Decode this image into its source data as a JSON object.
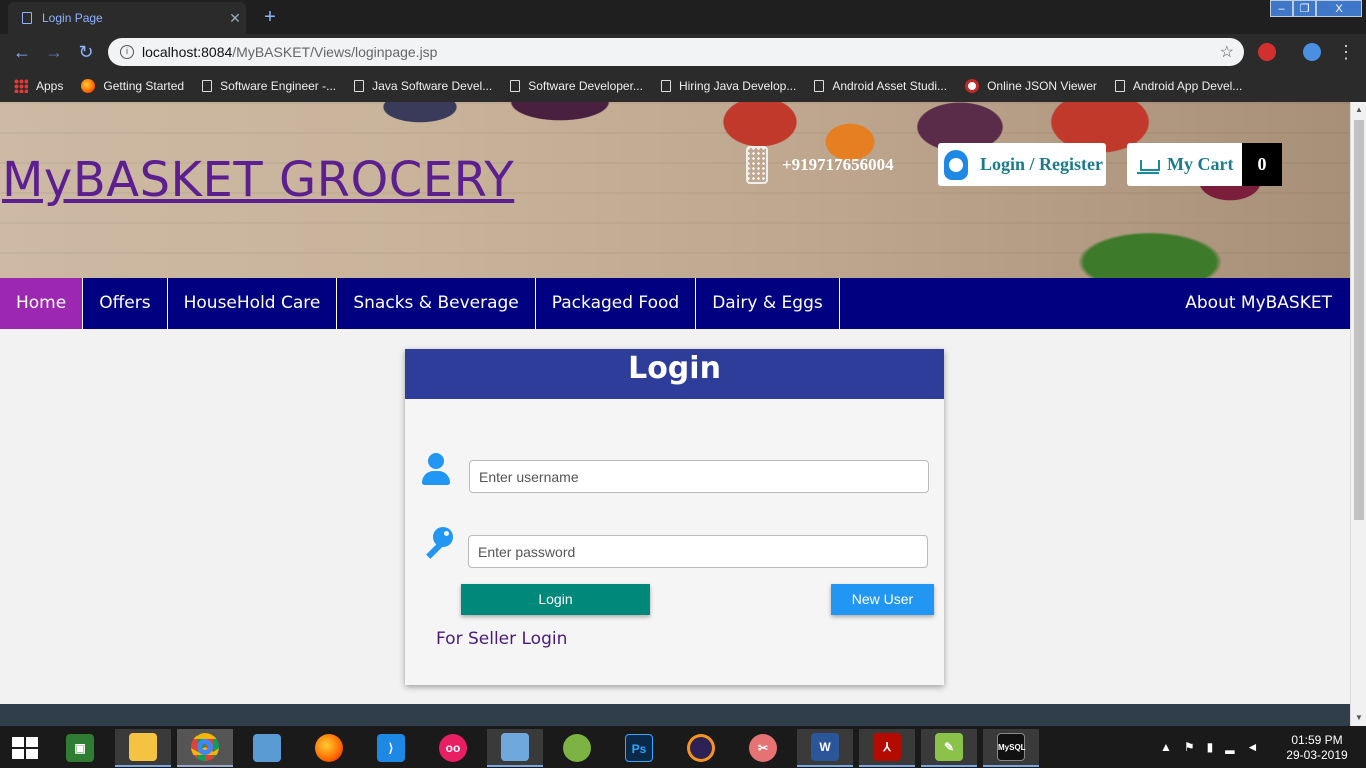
{
  "browser": {
    "tab_title": "Login Page",
    "new_tab_symbol": "+",
    "url_host": "localhost:8084",
    "url_path": "/MyBASKET/Views/loginpage.jsp",
    "window_controls": [
      "–",
      "❐",
      "X"
    ]
  },
  "bookmarks": [
    {
      "label": "Apps",
      "icon": "apps-icon"
    },
    {
      "label": "Getting Started",
      "icon": "firefox-icon"
    },
    {
      "label": "Software Engineer -...",
      "icon": "page-icon"
    },
    {
      "label": "Java Software Devel...",
      "icon": "page-icon"
    },
    {
      "label": "Software Developer...",
      "icon": "page-icon"
    },
    {
      "label": "Hiring Java Develop...",
      "icon": "page-icon"
    },
    {
      "label": "Android Asset Studi...",
      "icon": "page-icon"
    },
    {
      "label": "Online JSON Viewer",
      "icon": "json-icon"
    },
    {
      "label": "Android App Devel...",
      "icon": "page-icon"
    }
  ],
  "header": {
    "brand": "MyBASKET GROCERY",
    "phone": "+919717656004",
    "login_register": "Login / Register",
    "cart_label": "My Cart",
    "cart_count": "0"
  },
  "menu": {
    "items": [
      "Home",
      "Offers",
      "HouseHold Care",
      "Snacks & Beverage",
      "Packaged Food",
      "Dairy & Eggs"
    ],
    "active": "Home",
    "about": "About MyBASKET"
  },
  "login": {
    "title": "Login",
    "username_placeholder": "Enter username",
    "password_placeholder": "Enter password",
    "login_button": "Login",
    "new_user_button": "New User",
    "seller_link": "For Seller Login"
  },
  "taskbar": {
    "apps": [
      "file-explorer",
      "chrome",
      "control-panel",
      "firefox",
      "vscode",
      "flickr",
      "virtualbox",
      "android-studio",
      "photoshop",
      "eclipse",
      "snipping-tool",
      "word",
      "acrobat",
      "notepad-plus",
      "mysql"
    ],
    "time": "01:59 PM",
    "date": "29-03-2019"
  },
  "colors": {
    "menu_bg": "#000080",
    "menu_active": "#9c27b0",
    "card_header": "#2e3d9a",
    "login_btn": "#00897b",
    "new_user_btn": "#2196f3",
    "brand": "#5b1f8f"
  }
}
